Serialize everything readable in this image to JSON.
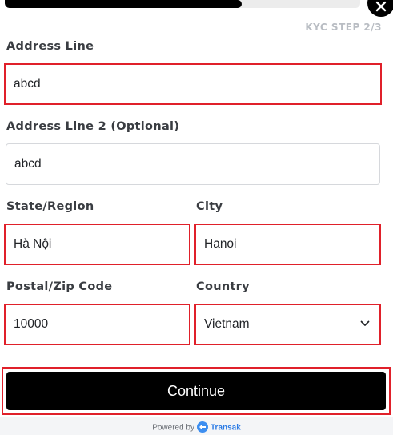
{
  "progress": {
    "fraction": 0.667
  },
  "header": {
    "kyc_step": "KYC STEP 2/3"
  },
  "form": {
    "address_line": {
      "label": "Address Line",
      "value": "abcd"
    },
    "address_line_2": {
      "label": "Address Line 2 (Optional)",
      "value": "abcd"
    },
    "state_region": {
      "label": "State/Region",
      "value": "Hà Nội"
    },
    "city": {
      "label": "City",
      "value": "Hanoi"
    },
    "postal_code": {
      "label": "Postal/Zip Code",
      "value": "10000"
    },
    "country": {
      "label": "Country",
      "value": "Vietnam"
    }
  },
  "actions": {
    "continue_label": "Continue"
  },
  "footer": {
    "powered_by": "Powered by",
    "brand": "Transak"
  },
  "colors": {
    "error_border": "#e0202a",
    "primary_button": "#000000",
    "brand_blue": "#2c7be5"
  },
  "icons": {
    "close": "close-icon",
    "chevron": "chevron-down-icon",
    "brand_logo": "transak-logo-icon"
  }
}
